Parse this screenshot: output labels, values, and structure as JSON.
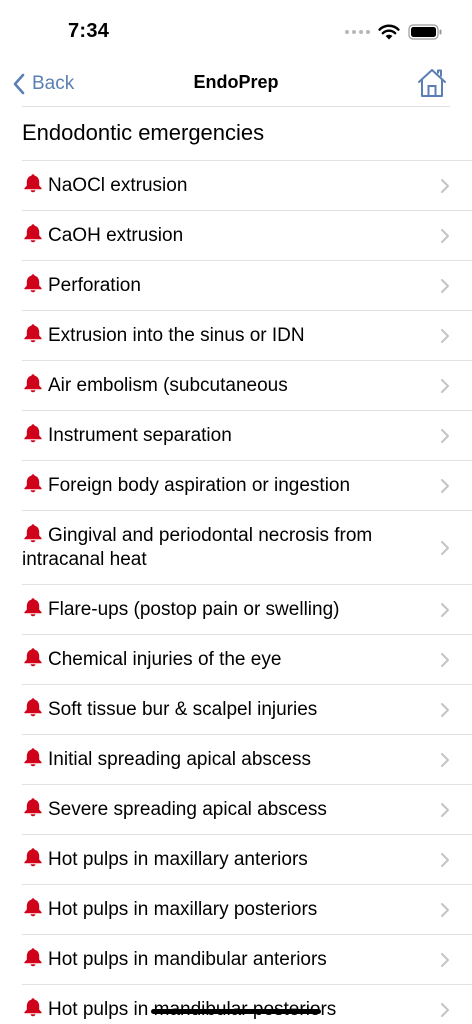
{
  "status": {
    "time": "7:34"
  },
  "nav": {
    "back_label": "Back",
    "title": "EndoPrep"
  },
  "section": {
    "title": "Endodontic emergencies"
  },
  "items": [
    "NaOCl extrusion",
    "CaOH extrusion",
    "Perforation",
    "Extrusion into the sinus or IDN",
    "Air embolism (subcutaneous",
    "Instrument separation",
    "Foreign body aspiration or ingestion",
    "Gingival and periodontal necrosis from intracanal heat",
    "Flare-ups (postop pain or swelling)",
    "Chemical injuries of the eye",
    "Soft tissue bur & scalpel injuries",
    "Initial spreading apical abscess",
    "Severe spreading apical abscess",
    "Hot pulps in maxillary anteriors",
    "Hot pulps in maxillary posteriors",
    "Hot pulps in mandibular anteriors",
    "Hot pulps in mandibular posteriors"
  ],
  "icons": {
    "item": "bell-icon",
    "disclosure": "chevron-right-icon",
    "home": "home-icon",
    "back": "chevron-left-icon"
  },
  "colors": {
    "accent": "#5b7fb4",
    "bell": "#d0021b",
    "chevron": "#c4c4c7",
    "divider": "#e2e2e2"
  }
}
